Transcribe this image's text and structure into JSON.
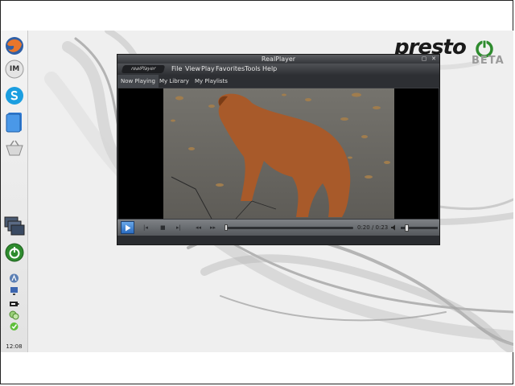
{
  "desktop": {
    "brand": "presto",
    "brand_tag": "BETA",
    "clock": "12:08"
  },
  "dock": {
    "icons": [
      "firefox-icon",
      "im-icon",
      "skype-icon",
      "documents-icon",
      "shopping-icon",
      "windows-switcher-icon",
      "power-icon"
    ],
    "im_label": "IM",
    "tray_icons": [
      "network-icon",
      "display-icon",
      "battery-icon",
      "chat-icon",
      "update-icon"
    ]
  },
  "window": {
    "title": "RealPlayer",
    "app_logo": "realPlayer",
    "menu": [
      "File",
      "View",
      "Play",
      "Favorites",
      "Tools",
      "Help"
    ],
    "tabs": [
      "Now Playing",
      "My Library",
      "My Playlists"
    ],
    "active_tab": "Now Playing",
    "time": "0:20 / 0:23",
    "progress": 0.0,
    "volume": 0.1
  },
  "colors": {
    "accent": "#2a6bbf",
    "power_green": "#2e8b2e",
    "window_dark": "#3a3c40"
  }
}
